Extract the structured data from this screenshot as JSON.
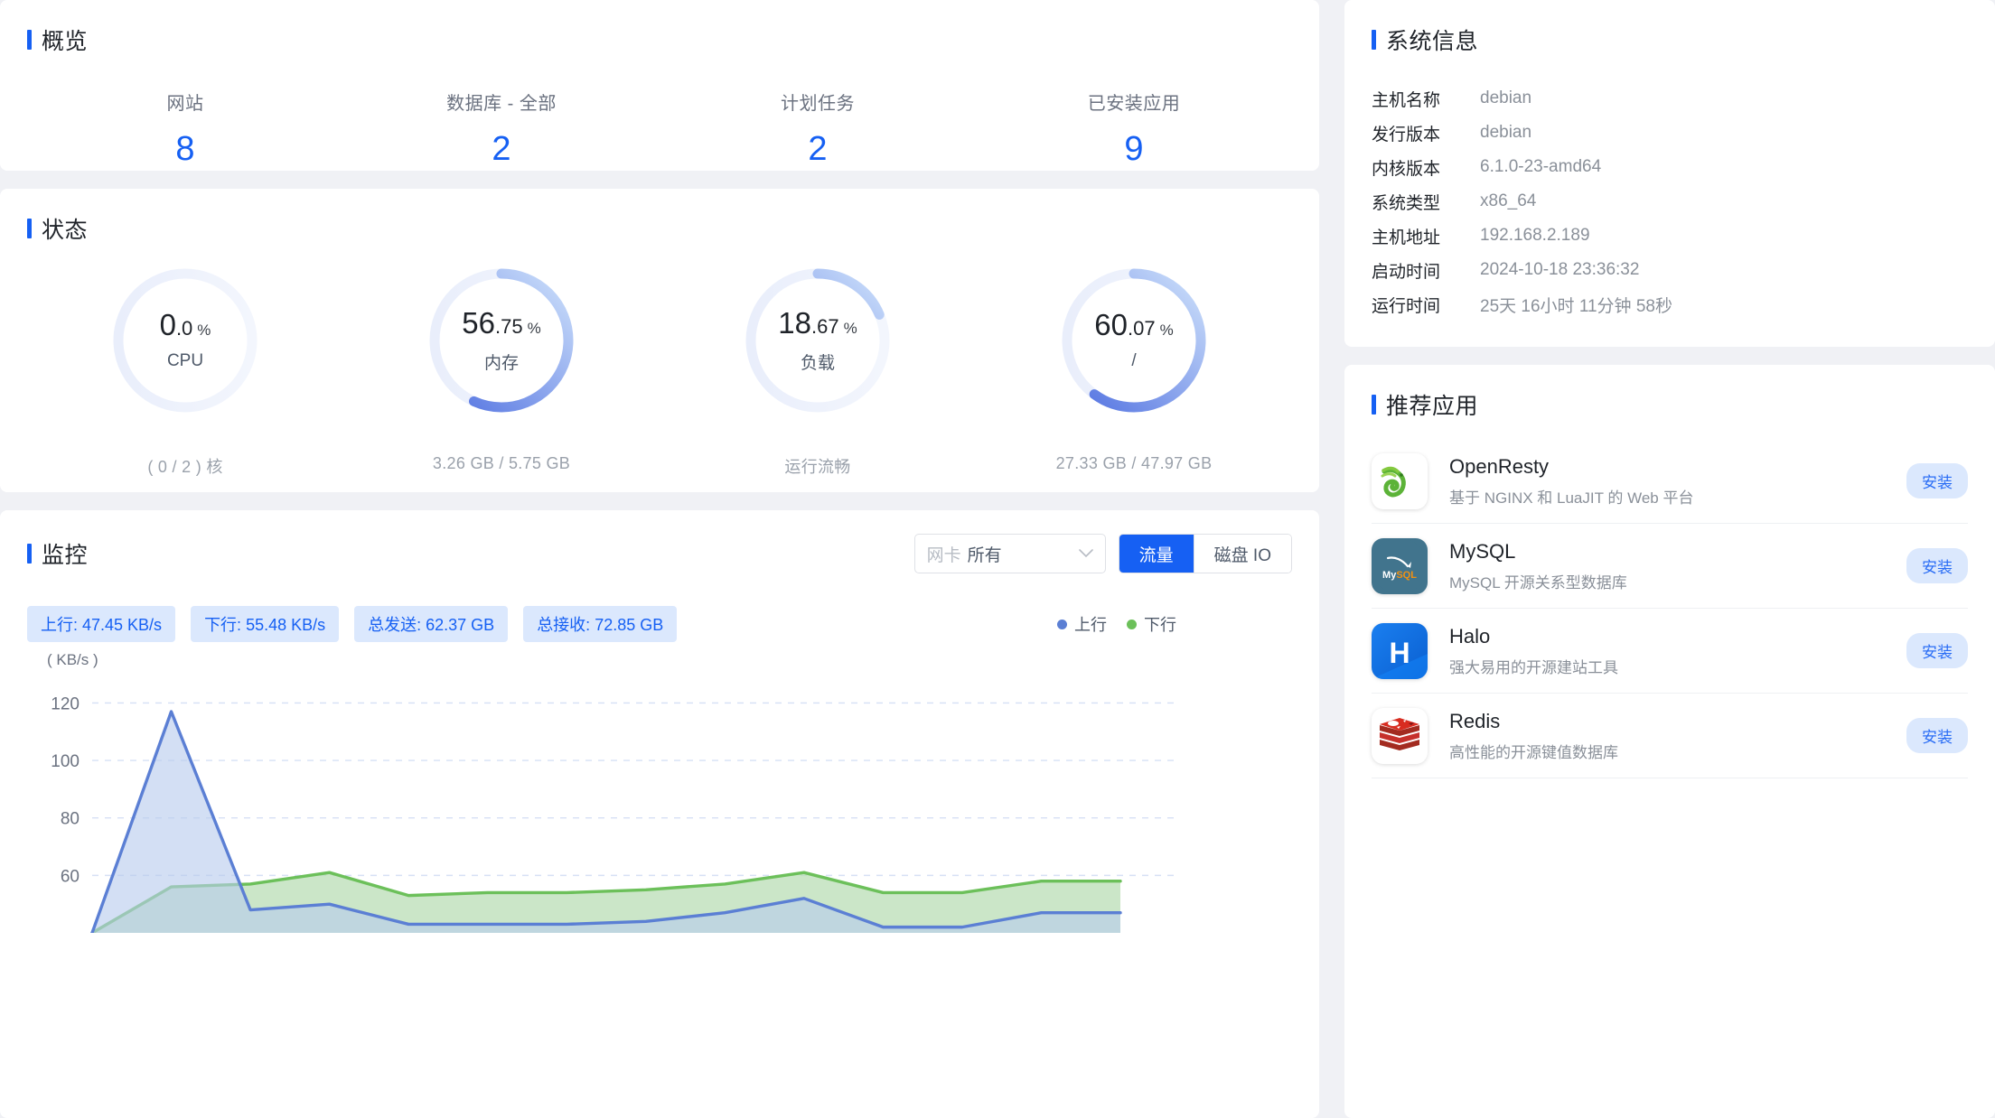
{
  "overview": {
    "title": "概览",
    "items": [
      {
        "label": "网站",
        "value": "8"
      },
      {
        "label": "数据库 - 全部",
        "value": "2"
      },
      {
        "label": "计划任务",
        "value": "2"
      },
      {
        "label": "已安装应用",
        "value": "9"
      }
    ]
  },
  "status": {
    "title": "状态",
    "gauges": [
      {
        "int": "0",
        "dec": ".0",
        "pct": "%",
        "name": "CPU",
        "sub": "( 0 / 2 ) 核",
        "percent": 0
      },
      {
        "int": "56",
        "dec": ".75",
        "pct": "%",
        "name": "内存",
        "sub": "3.26 GB / 5.75 GB",
        "percent": 56.75
      },
      {
        "int": "18",
        "dec": ".67",
        "pct": "%",
        "name": "负载",
        "sub": "运行流畅",
        "percent": 18.67
      },
      {
        "int": "60",
        "dec": ".07",
        "pct": "%",
        "name": "/",
        "sub": "27.33 GB / 47.97 GB",
        "percent": 60.07
      }
    ]
  },
  "monitor": {
    "title": "监控",
    "nic_prefix": "网卡",
    "nic_value": "所有",
    "chevron": "chevron-down-icon",
    "tabs": [
      {
        "label": "流量",
        "active": true
      },
      {
        "label": "磁盘 IO",
        "active": false
      }
    ],
    "chips": [
      "上行: 47.45 KB/s",
      "下行: 55.48 KB/s",
      "总发送: 62.37 GB",
      "总接收: 72.85 GB"
    ],
    "legend": [
      {
        "label": "上行",
        "color": "#5b7fd4"
      },
      {
        "label": "下行",
        "color": "#6cc05a"
      }
    ]
  },
  "chart_data": {
    "type": "area",
    "title": "监控",
    "xlabel": "",
    "ylabel": "( KB/s )",
    "yticks": [
      120,
      100,
      80,
      60
    ],
    "ylim": [
      40,
      128
    ],
    "grid": true,
    "legend_position": "top-right",
    "x": [
      0,
      1,
      2,
      3,
      4,
      5,
      6,
      7,
      8,
      9,
      10,
      11,
      12,
      13
    ],
    "series": [
      {
        "name": "上行",
        "color": "#5b7fd4",
        "fill": "#b8ccee",
        "values": [
          40,
          117,
          48,
          50,
          43,
          43,
          43,
          44,
          47,
          52,
          42,
          42,
          47,
          47
        ]
      },
      {
        "name": "下行",
        "color": "#6cc05a",
        "fill": "#b7ddb3",
        "values": [
          40,
          56,
          57,
          61,
          53,
          54,
          54,
          55,
          57,
          61,
          54,
          54,
          58,
          58
        ]
      }
    ]
  },
  "sysinfo": {
    "title": "系统信息",
    "rows": [
      {
        "key": "主机名称",
        "value": "debian"
      },
      {
        "key": "发行版本",
        "value": "debian"
      },
      {
        "key": "内核版本",
        "value": "6.1.0-23-amd64"
      },
      {
        "key": "系统类型",
        "value": "x86_64"
      },
      {
        "key": "主机地址",
        "value": "192.168.2.189"
      },
      {
        "key": "启动时间",
        "value": "2024-10-18 23:36:32"
      },
      {
        "key": "运行时间",
        "value": "25天 16小时 11分钟 58秒"
      }
    ]
  },
  "apps": {
    "title": "推荐应用",
    "install_label": "安装",
    "items": [
      {
        "name": "OpenResty",
        "desc": "基于 NGINX 和 LuaJIT 的 Web 平台",
        "icon": "openresty-icon"
      },
      {
        "name": "MySQL",
        "desc": "MySQL 开源关系型数据库",
        "icon": "mysql-icon"
      },
      {
        "name": "Halo",
        "desc": "强大易用的开源建站工具",
        "icon": "halo-icon"
      },
      {
        "name": "Redis",
        "desc": "高性能的开源键值数据库",
        "icon": "redis-icon"
      }
    ]
  },
  "colors": {
    "accent": "#1660f3",
    "chip_bg": "#dbe8fd",
    "upload": "#5b7fd4",
    "download": "#6cc05a"
  }
}
